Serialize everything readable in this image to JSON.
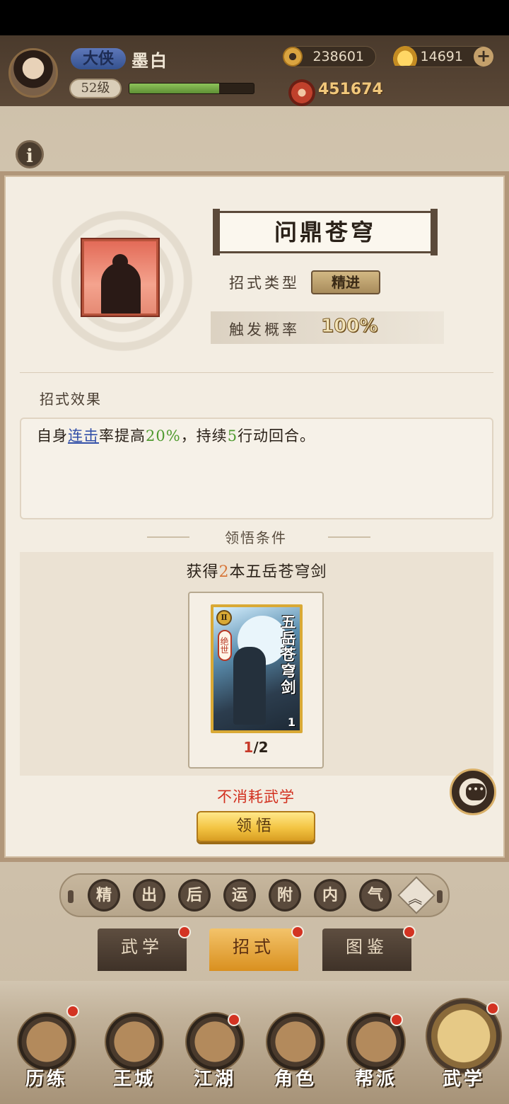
{
  "header": {
    "rank": "大侠",
    "player_name": "墨白",
    "level": "52级",
    "exp_fraction": 0.72,
    "coins": "238601",
    "ingots": "14691",
    "add_label": "+",
    "power": "451674"
  },
  "info_label": "i",
  "skill": {
    "name": "问鼎苍穹",
    "type_label": "招式类型",
    "type_value": "精进",
    "rate_label": "触发概率",
    "rate_value": "100%",
    "effect_heading": "招式效果",
    "effect": {
      "p1": "自身",
      "link": "连击",
      "p2": "率提高",
      "pct": "20%",
      "p3": "，持续",
      "turns": "5",
      "p4": "行动回合。"
    },
    "condition_heading": "领悟条件",
    "condition": {
      "p1": "获得",
      "count": "2",
      "p2": "本五岳苍穹剑"
    },
    "book": {
      "title": "五岳苍穹剑",
      "tag": "绝世",
      "rank_mark": "Ⅱ",
      "count": "1",
      "have": "1",
      "need": "/2"
    },
    "no_cost_note": "不消耗武学",
    "comprehend_label": "领悟"
  },
  "chat_icon_glyph": "•••",
  "filters": [
    "精",
    "出",
    "后",
    "运",
    "附",
    "内",
    "气"
  ],
  "filter_more_glyph": "︽",
  "sub_tabs": [
    "武学",
    "招式",
    "图鉴"
  ],
  "nav": [
    "历练",
    "王城",
    "江湖",
    "角色",
    "帮派",
    "武学"
  ],
  "colors": {
    "accent_gold": "#f3c442",
    "alert_red": "#d2301f",
    "link_blue": "#3350a8",
    "value_green": "#4f9a2f",
    "count_orange": "#d7773a"
  }
}
